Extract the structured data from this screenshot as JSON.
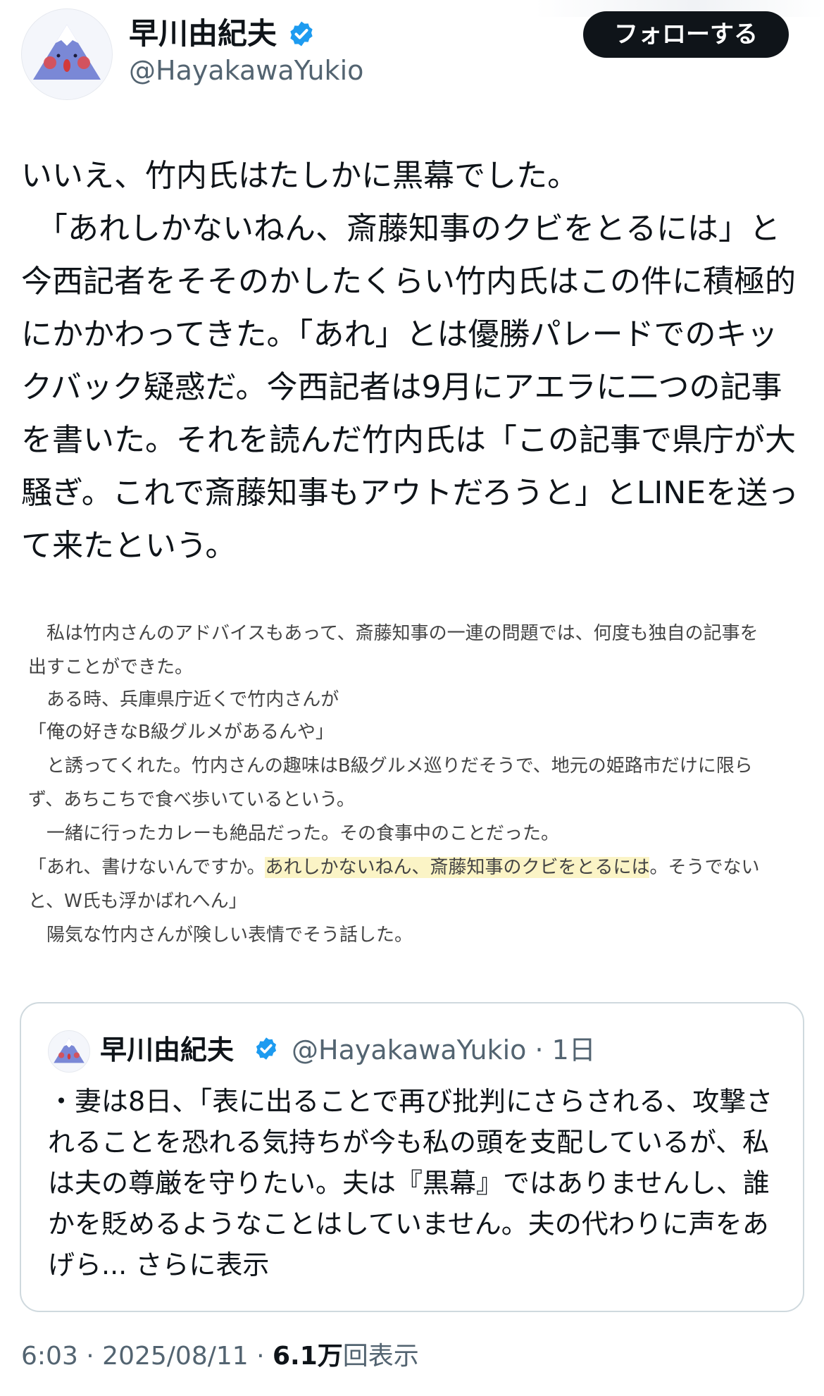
{
  "author": {
    "display_name": "早川由紀夫",
    "handle": "@HayakawaYukio",
    "avatar_icon": "mount-fuji-face-icon",
    "verified_icon": "verified-badge-icon",
    "verified_color": "#1d9bf0"
  },
  "follow_button": {
    "label": "フォローする"
  },
  "tweet": {
    "text": "いいえ、竹内氏はたしかに黒幕でした。\n　「あれしかないねん、斎藤知事のクビをとるには」と今西記者をそそのかしたくらい竹内氏はこの件に積極的にかかわってきた。「あれ」とは優勝パレードでのキックバック疑惑だ。今西記者は9月にアエラに二つの記事を書いた。それを読んだ竹内氏は「この記事で県庁が大騒ぎ。これで斎藤知事もアウトだろうと」とLINEを送って来たという。"
  },
  "clip": {
    "lines": [
      "　私は竹内さんのアドバイスもあって、斎藤知事の一連の問題では、何度も独自の記事を",
      "出すことができた。",
      "　ある時、兵庫県庁近くで竹内さんが",
      "「俺の好きなB級グルメがあるんや」",
      "　と誘ってくれた。竹内さんの趣味はB級グルメ巡りだそうで、地元の姫路市だけに限ら",
      "ず、あちこちで食べ歩いているという。",
      "　一緒に行ったカレーも絶品だった。その食事中のことだった。",
      "「あれ、書けないんですか。",
      "あれしかないねん、斎藤知事のクビをとるには",
      "。そうでない",
      "と、W氏も浮かばれへん」",
      "　陽気な竹内さんが険しい表情でそう話した。"
    ],
    "highlight_color": "#fbf4c6"
  },
  "quote": {
    "display_name": "早川由紀夫",
    "handle_time": "@HayakawaYukio · 1日",
    "text": "・妻は8日、「表に出ることで再び批判にさらされる、攻撃されることを恐れる気持ちが今も私の頭を支配しているが、私は夫の尊厳を守りたい。夫は『黒幕』ではありませんし、誰かを貶めるようなことはしていません。夫の代わりに声をあげら... ",
    "more_label": "さらに表示"
  },
  "meta": {
    "time_date": "6:03 · 2025/08/11 · ",
    "views_count": "6.1万",
    "views_label": "回表示"
  }
}
